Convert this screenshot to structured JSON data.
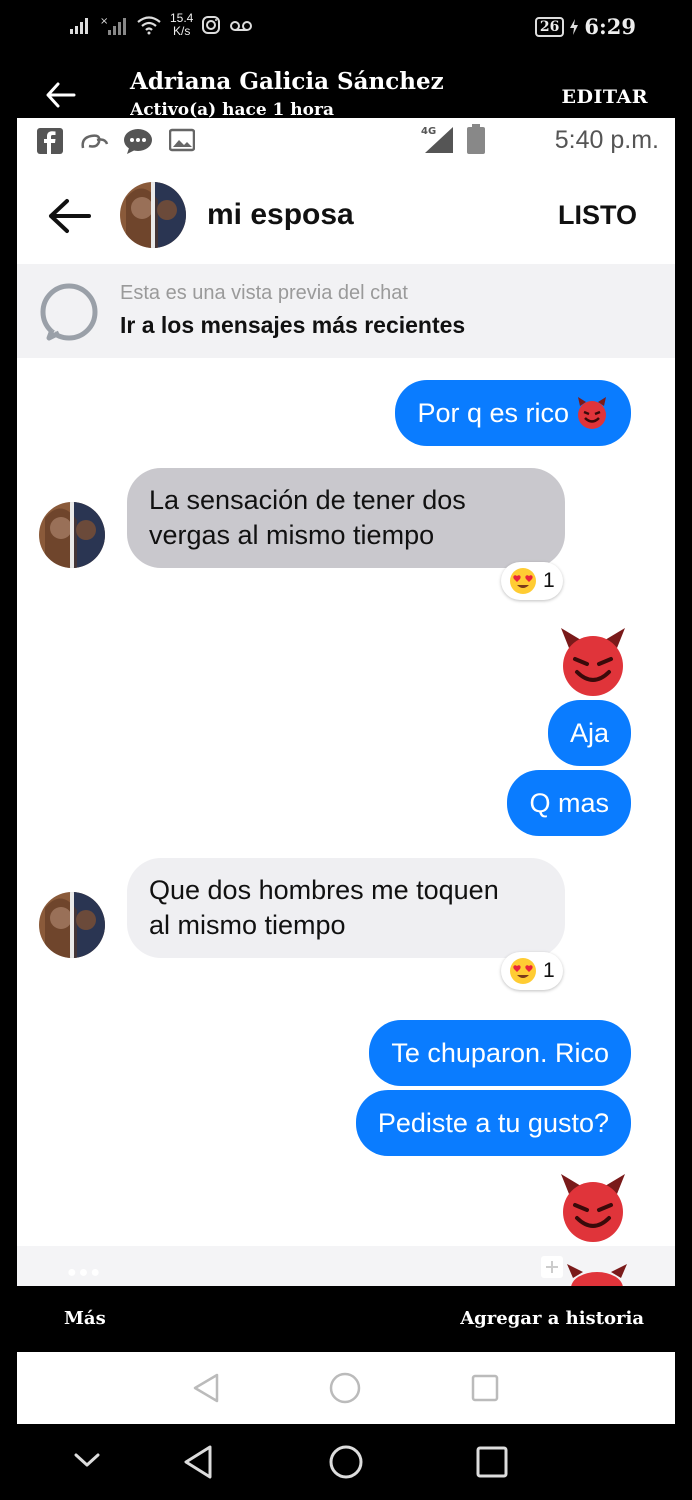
{
  "os_status": {
    "network_speed_value": "15.4",
    "network_speed_unit": "K/s",
    "battery": "26",
    "time": "6:29"
  },
  "story_header": {
    "name": "Adriana Galicia Sánchez",
    "subtitle": "Activo(a) hace 1 hora",
    "edit_label": "EDITAR"
  },
  "inner_status": {
    "network": "4G",
    "time": "5:40 p.m."
  },
  "chat": {
    "title": "mi esposa",
    "done_label": "LISTO",
    "preview_line1": "Esta es una vista previa del chat",
    "preview_line2": "Ir a los mensajes más recientes",
    "messages": [
      {
        "dir": "out",
        "text": "Por q es rico",
        "emoji": "smiling-devil"
      },
      {
        "dir": "in",
        "line1": "La sensación de tener dos",
        "line2": "vergas al mismo tiempo",
        "reaction": "heart-eyes",
        "reaction_count": "1"
      },
      {
        "dir": "out",
        "type": "emoji",
        "emoji": "smiling-devil"
      },
      {
        "dir": "out",
        "text": "Aja"
      },
      {
        "dir": "out",
        "text": "Q mas"
      },
      {
        "dir": "in",
        "line1": "Que dos hombres me toquen",
        "line2": "al mismo tiempo",
        "reaction": "heart-eyes",
        "reaction_count": "1"
      },
      {
        "dir": "out",
        "text": "Te chuparon. Rico"
      },
      {
        "dir": "out",
        "text": "Pediste a tu gusto?"
      },
      {
        "dir": "out",
        "type": "emoji",
        "emoji": "smiling-devil"
      }
    ]
  },
  "story_bottom": {
    "more_label": "Más",
    "add_story_label": "Agregar a historia"
  },
  "colors": {
    "outgoing_bubble": "#0a7cff",
    "incoming_bubble_grey": "#c9c8cd",
    "incoming_bubble_light": "#efeff2",
    "background": "#000000"
  }
}
